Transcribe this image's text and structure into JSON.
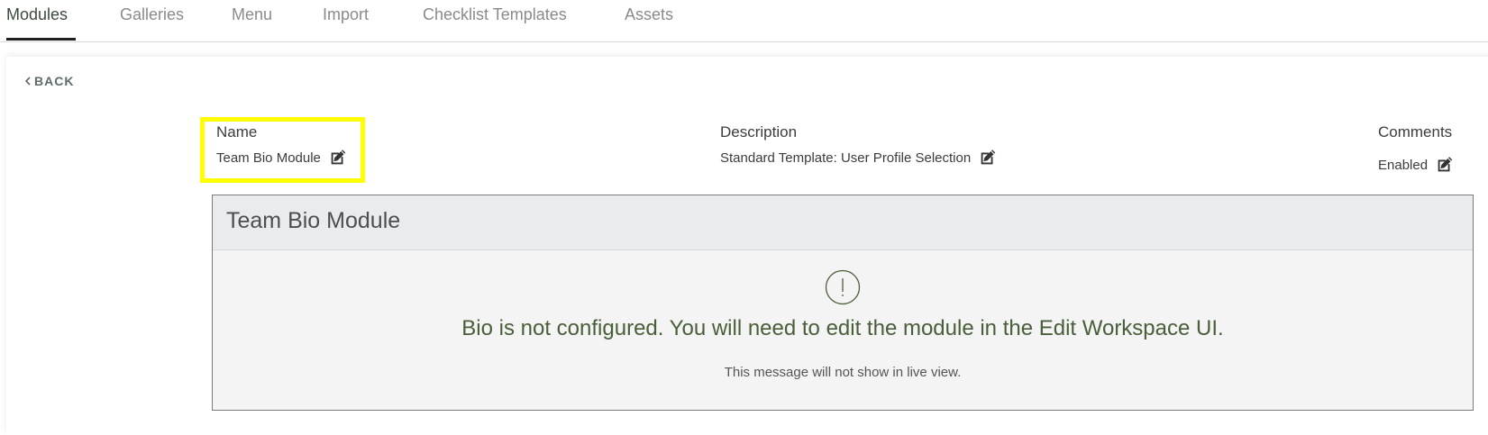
{
  "tabs": [
    {
      "label": "Modules",
      "active": true
    },
    {
      "label": "Galleries",
      "active": false
    },
    {
      "label": "Menu",
      "active": false
    },
    {
      "label": "Import",
      "active": false
    },
    {
      "label": "Checklist Templates",
      "active": false
    },
    {
      "label": "Assets",
      "active": false
    }
  ],
  "back_label": "BACK",
  "fields": {
    "name": {
      "label": "Name",
      "value": "Team Bio Module"
    },
    "description": {
      "label": "Description",
      "value": "Standard Template: User Profile Selection"
    },
    "comments": {
      "label": "Comments",
      "value": "Enabled"
    }
  },
  "module": {
    "title": "Team Bio Module",
    "message": "Bio is not configured. You will need to edit the module in the Edit Workspace UI.",
    "submessage": "This message will not show in live view."
  },
  "colors": {
    "highlight": "#ffff00",
    "message_green": "#4a5e3a",
    "active_tab": "#3b4a3b"
  },
  "icons": {
    "edit": "edit-icon",
    "warning": "exclamation-circle-icon",
    "back": "chevron-left-icon"
  }
}
